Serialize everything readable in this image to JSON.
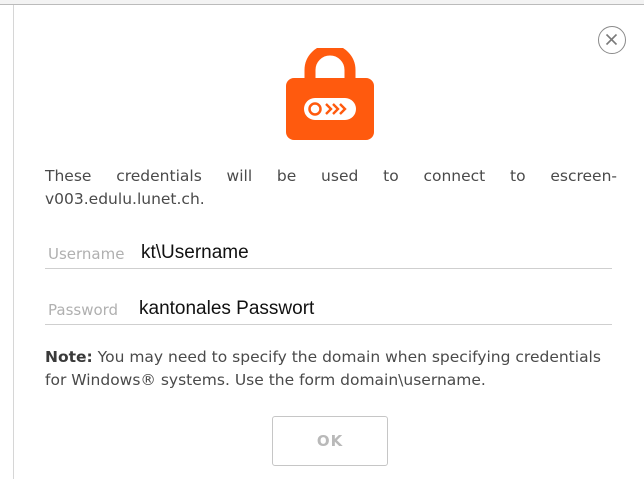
{
  "dialog": {
    "description": "These credentials will be used to connect to escreen-v003.edulu.lunet.ch.",
    "username": {
      "label": "Username",
      "value": "kt\\Username"
    },
    "password": {
      "label": "Password",
      "value": "kantonales Passwort"
    },
    "note": {
      "prefix": "Note:",
      "text": " You may need to specify the domain when specifying credentials for Windows® systems. Use the form domain\\username."
    },
    "ok_label": "OK"
  },
  "icons": {
    "close": "close-icon",
    "lock": "lock-icon"
  },
  "colors": {
    "accent": "#ff5a0e",
    "field_label": "#b0b0b0",
    "disabled_text": "#b9b9b9"
  }
}
